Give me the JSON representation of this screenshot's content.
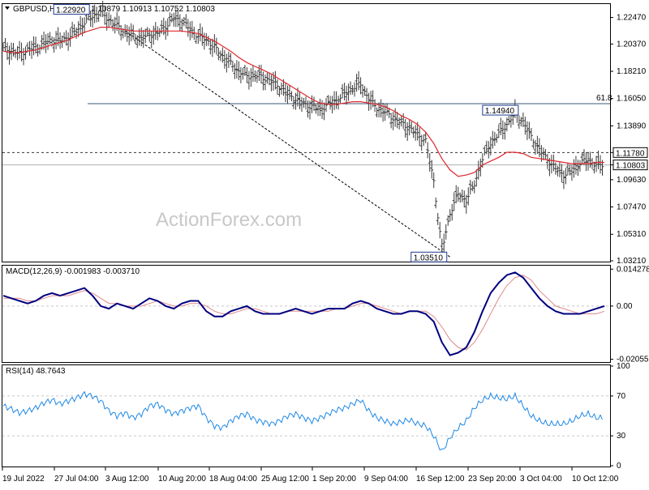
{
  "header": {
    "symbol": "GBPUSD,H4",
    "ohlc": "1.10879 1.10913 1.10752 1.10803"
  },
  "watermark": "ActionForex.com",
  "colors": {
    "ma": "#e0262c",
    "macd": "#000080",
    "signal": "#e08a8a",
    "rsi": "#1e88e5",
    "grid": "#c8c8c8",
    "price": "#3a3a3a"
  },
  "chart_data": [
    {
      "type": "line",
      "pane": "price",
      "ylim": [
        1.0321,
        1.2347
      ],
      "y_ticks": [
        "1.22470",
        "1.20370",
        "1.18210",
        "1.16050",
        "1.13890",
        "1.11780",
        "1.10803",
        "1.09630",
        "1.07470",
        "1.05310",
        "1.03210"
      ],
      "x_labels": [
        "19 Jul 2022",
        "27 Jul 04:00",
        "3 Aug 12:00",
        "10 Aug 20:00",
        "18 Aug 04:00",
        "25 Aug 12:00",
        "1 Sep 20:00",
        "9 Sep 04:00",
        "16 Sep 12:00",
        "23 Sep 20:00",
        "3 Oct 04:00",
        "10 Oct 12:00"
      ],
      "series": [
        {
          "values": [
            1.2,
            1.198,
            1.196,
            1.199,
            1.201,
            1.204,
            1.207,
            1.206,
            1.209,
            1.214,
            1.221,
            1.226,
            1.229,
            1.223,
            1.218,
            1.213,
            1.21,
            1.208,
            1.211,
            1.212,
            1.218,
            1.224,
            1.222,
            1.215,
            1.21,
            1.207,
            1.201,
            1.194,
            1.188,
            1.182,
            1.178,
            1.179,
            1.177,
            1.174,
            1.17,
            1.164,
            1.16,
            1.156,
            1.154,
            1.152,
            1.156,
            1.159,
            1.164,
            1.169,
            1.172,
            1.16,
            1.153,
            1.15,
            1.145,
            1.141,
            1.137,
            1.132,
            1.127,
            1.095,
            1.04,
            1.07,
            1.085,
            1.08,
            1.093,
            1.113,
            1.125,
            1.133,
            1.14,
            1.149,
            1.142,
            1.13,
            1.12,
            1.112,
            1.105,
            1.1,
            1.103,
            1.11,
            1.112,
            1.108,
            1.108
          ]
        },
        {
          "name": "",
          "values": [
            1.198,
            1.197,
            1.197,
            1.198,
            1.199,
            1.201,
            1.203,
            1.205,
            1.207,
            1.21,
            1.213,
            1.215,
            1.217,
            1.217,
            1.216,
            1.215,
            1.214,
            1.214,
            1.214,
            1.214,
            1.214,
            1.214,
            1.214,
            1.213,
            1.212,
            1.209,
            1.206,
            1.202,
            1.198,
            1.193,
            1.189,
            1.186,
            1.183,
            1.18,
            1.176,
            1.172,
            1.168,
            1.164,
            1.16,
            1.157,
            1.156,
            1.156,
            1.157,
            1.158,
            1.158,
            1.157,
            1.156,
            1.154,
            1.151,
            1.147,
            1.144,
            1.14,
            1.134,
            1.125,
            1.113,
            1.104,
            1.099,
            1.1,
            1.102,
            1.108,
            1.111,
            1.114,
            1.118,
            1.118,
            1.117,
            1.114,
            1.113,
            1.112,
            1.111,
            1.11,
            1.109,
            1.109,
            1.109,
            1.11,
            1.11
          ]
        }
      ],
      "annotations": [
        {
          "text": "1.22920",
          "x": 12,
          "y": 1.2292
        },
        {
          "text": "1.03510",
          "x": 55,
          "y": 1.0351
        },
        {
          "text": "1.14940",
          "x": 64,
          "y": 1.1494
        },
        {
          "text": "61.8",
          "x": 74,
          "y": 1.1565
        }
      ],
      "hlines": [
        {
          "y": 1.1565
        },
        {
          "y": 1.1178,
          "style": "dotted",
          "label": "1.11780"
        },
        {
          "y": 1.108,
          "style": "solid-light",
          "label": "1.10803"
        }
      ],
      "trendline": {
        "from": [
          15,
          1.2141
        ],
        "to": [
          55,
          1.0351
        ]
      }
    },
    {
      "type": "line",
      "pane": "macd",
      "title": "MACD(12,26,9) -0.001983 -0.003710",
      "ylim": [
        -0.021,
        0.015
      ],
      "y_ticks": [
        "0.014278",
        "0.00",
        "-0.020556"
      ],
      "series": [
        {
          "values": [
            0.004,
            0.003,
            0.002,
            0.001,
            0.002,
            0.004,
            0.005,
            0.004,
            0.005,
            0.006,
            0.007,
            0.004,
            0.0,
            -0.001,
            0.001,
            0.0,
            -0.001,
            0.001,
            0.003,
            0.002,
            0.0,
            -0.001,
            0.001,
            0.002,
            0.002,
            -0.002,
            -0.004,
            -0.004,
            -0.002,
            -0.001,
            0.0,
            -0.002,
            -0.003,
            -0.003,
            -0.003,
            -0.002,
            -0.001,
            -0.002,
            -0.003,
            -0.002,
            -0.001,
            -0.001,
            -0.001,
            0.001,
            0.002,
            0.001,
            -0.001,
            -0.002,
            -0.003,
            -0.003,
            -0.002,
            -0.002,
            -0.003,
            -0.006,
            -0.014,
            -0.019,
            -0.018,
            -0.016,
            -0.01,
            -0.002,
            0.005,
            0.009,
            0.012,
            0.013,
            0.011,
            0.007,
            0.003,
            0.0,
            -0.002,
            -0.003,
            -0.003,
            -0.003,
            -0.002,
            -0.001,
            0.0
          ]
        },
        {
          "values": [
            0.003,
            0.003,
            0.003,
            0.002,
            0.002,
            0.003,
            0.004,
            0.004,
            0.004,
            0.005,
            0.006,
            0.005,
            0.003,
            0.001,
            0.001,
            0.0,
            0.0,
            0.0,
            0.001,
            0.002,
            0.001,
            0.0,
            0.0,
            0.001,
            0.001,
            0.0,
            -0.002,
            -0.003,
            -0.003,
            -0.002,
            -0.001,
            -0.001,
            -0.002,
            -0.003,
            -0.003,
            -0.002,
            -0.002,
            -0.002,
            -0.002,
            -0.002,
            -0.002,
            -0.001,
            -0.001,
            0.0,
            0.001,
            0.001,
            0.0,
            -0.001,
            -0.002,
            -0.003,
            -0.002,
            -0.002,
            -0.002,
            -0.004,
            -0.008,
            -0.013,
            -0.016,
            -0.017,
            -0.014,
            -0.009,
            -0.003,
            0.003,
            0.008,
            0.011,
            0.012,
            0.01,
            0.006,
            0.003,
            0.0,
            -0.001,
            -0.002,
            -0.003,
            -0.003,
            -0.003,
            -0.002
          ]
        }
      ]
    },
    {
      "type": "line",
      "pane": "rsi",
      "title": "RSI(14) 48.7643",
      "ylim": [
        0,
        100
      ],
      "y_ticks": [
        "100",
        "70",
        "30",
        "0"
      ],
      "levels": [
        70,
        30
      ],
      "series": [
        {
          "values": [
            60,
            57,
            53,
            55,
            58,
            63,
            66,
            62,
            65,
            68,
            72,
            70,
            65,
            55,
            50,
            53,
            48,
            52,
            60,
            62,
            56,
            52,
            55,
            58,
            60,
            48,
            40,
            38,
            45,
            50,
            52,
            46,
            44,
            42,
            45,
            50,
            52,
            48,
            45,
            48,
            52,
            56,
            58,
            62,
            66,
            55,
            48,
            45,
            42,
            44,
            46,
            42,
            40,
            30,
            14,
            28,
            38,
            45,
            58,
            66,
            70,
            68,
            67,
            70,
            60,
            50,
            45,
            42,
            42,
            42,
            45,
            50,
            52,
            48,
            48
          ]
        }
      ]
    }
  ]
}
